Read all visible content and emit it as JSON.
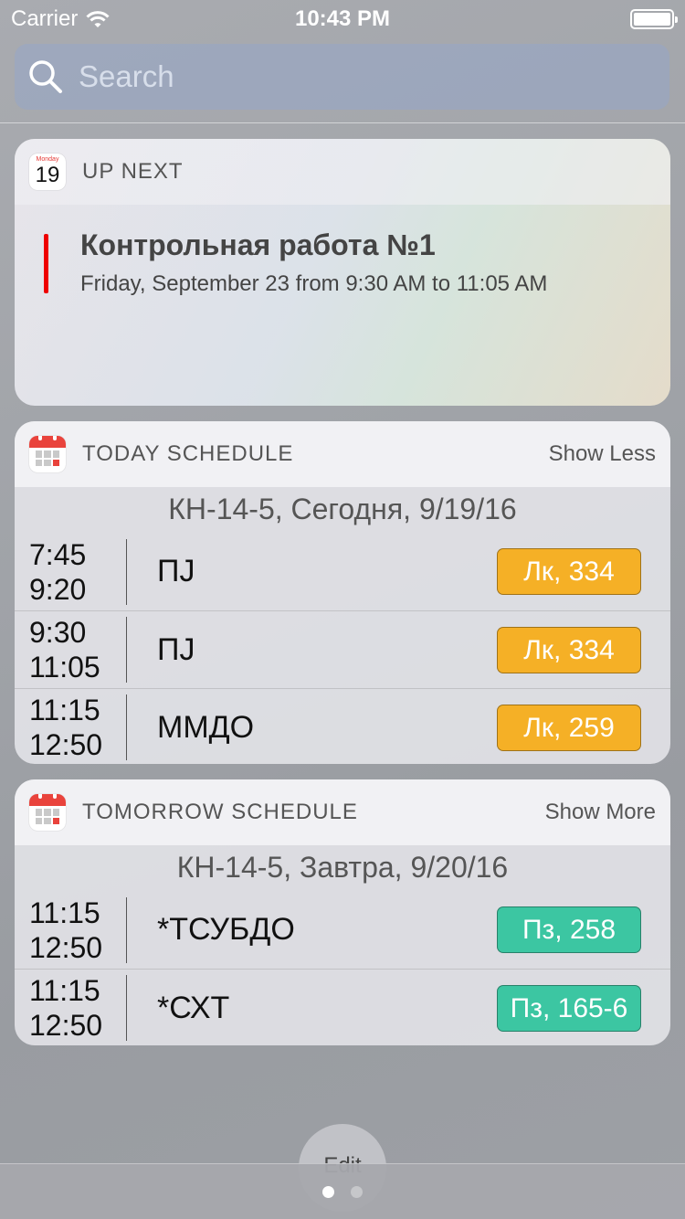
{
  "status_bar": {
    "carrier": "Carrier",
    "time": "10:43 PM"
  },
  "search": {
    "placeholder": "Search"
  },
  "up_next": {
    "app_icon": {
      "weekday": "Monday",
      "day": "19"
    },
    "title": "UP NEXT",
    "event_title": "Контрольная работа №1",
    "event_time": "Friday, September 23 from 9:30 AM to 11:05 AM",
    "accent_color": "#e00000"
  },
  "today": {
    "title": "TODAY SCHEDULE",
    "action": "Show Less",
    "date_line": "КН-14-5, Сегодня, 9/19/16",
    "rows": [
      {
        "start": "7:45",
        "end": "9:20",
        "subject": "ПЈ",
        "room": "Лк, 334"
      },
      {
        "start": "9:30",
        "end": "11:05",
        "subject": "ПЈ",
        "room": "Лк, 334"
      },
      {
        "start": "11:15",
        "end": "12:50",
        "subject": "ММДО",
        "room": "Лк, 259"
      }
    ]
  },
  "tomorrow": {
    "title": "TOMORROW SCHEDULE",
    "action": "Show More",
    "date_line": "КН-14-5, Завтра, 9/20/16",
    "rows": [
      {
        "start": "11:15",
        "end": "12:50",
        "subject": "*ТСУБДО",
        "room": "Пз, 258"
      },
      {
        "start": "11:15",
        "end": "12:50",
        "subject": "*СХТ",
        "room": "Пз, 165-6"
      }
    ]
  },
  "colors": {
    "lecture": "#f5b026",
    "practice": "#3cc6a2"
  },
  "bottom": {
    "edit": "Edit",
    "pages": 2,
    "current_page": 1
  }
}
